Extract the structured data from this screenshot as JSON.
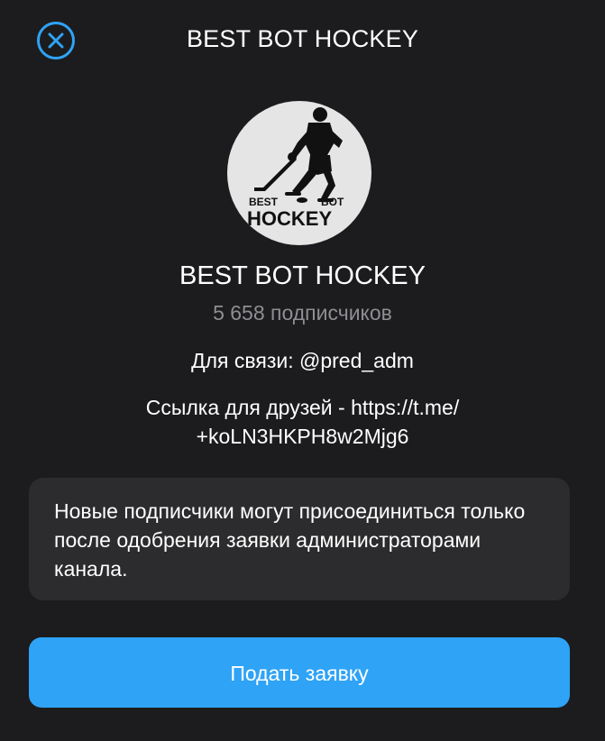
{
  "header": {
    "title": "BEST BOT HOCKEY",
    "close_icon": "close-circle-icon"
  },
  "channel": {
    "avatar_text_top_left": "BEST",
    "avatar_text_top_right": "BOT",
    "avatar_text_bottom": "HOCKEY",
    "name": "BEST BOT HOCKEY",
    "subscribers": "5 658 подписчиков",
    "description_line1": "Для связи: @pred_adm",
    "description_line2": "Ссылка для друзей - https://t.me/",
    "description_line3": "+koLN3HKPH8w2Mjg6"
  },
  "notice": {
    "text": "Новые подписчики могут присоединиться только после одобрения заявки администраторами канала."
  },
  "action": {
    "join_label": "Подать заявку"
  },
  "colors": {
    "background": "#1c1c1e",
    "accent": "#2fa3f6",
    "card": "#2c2c2e",
    "secondary_text": "#8e8e93"
  }
}
